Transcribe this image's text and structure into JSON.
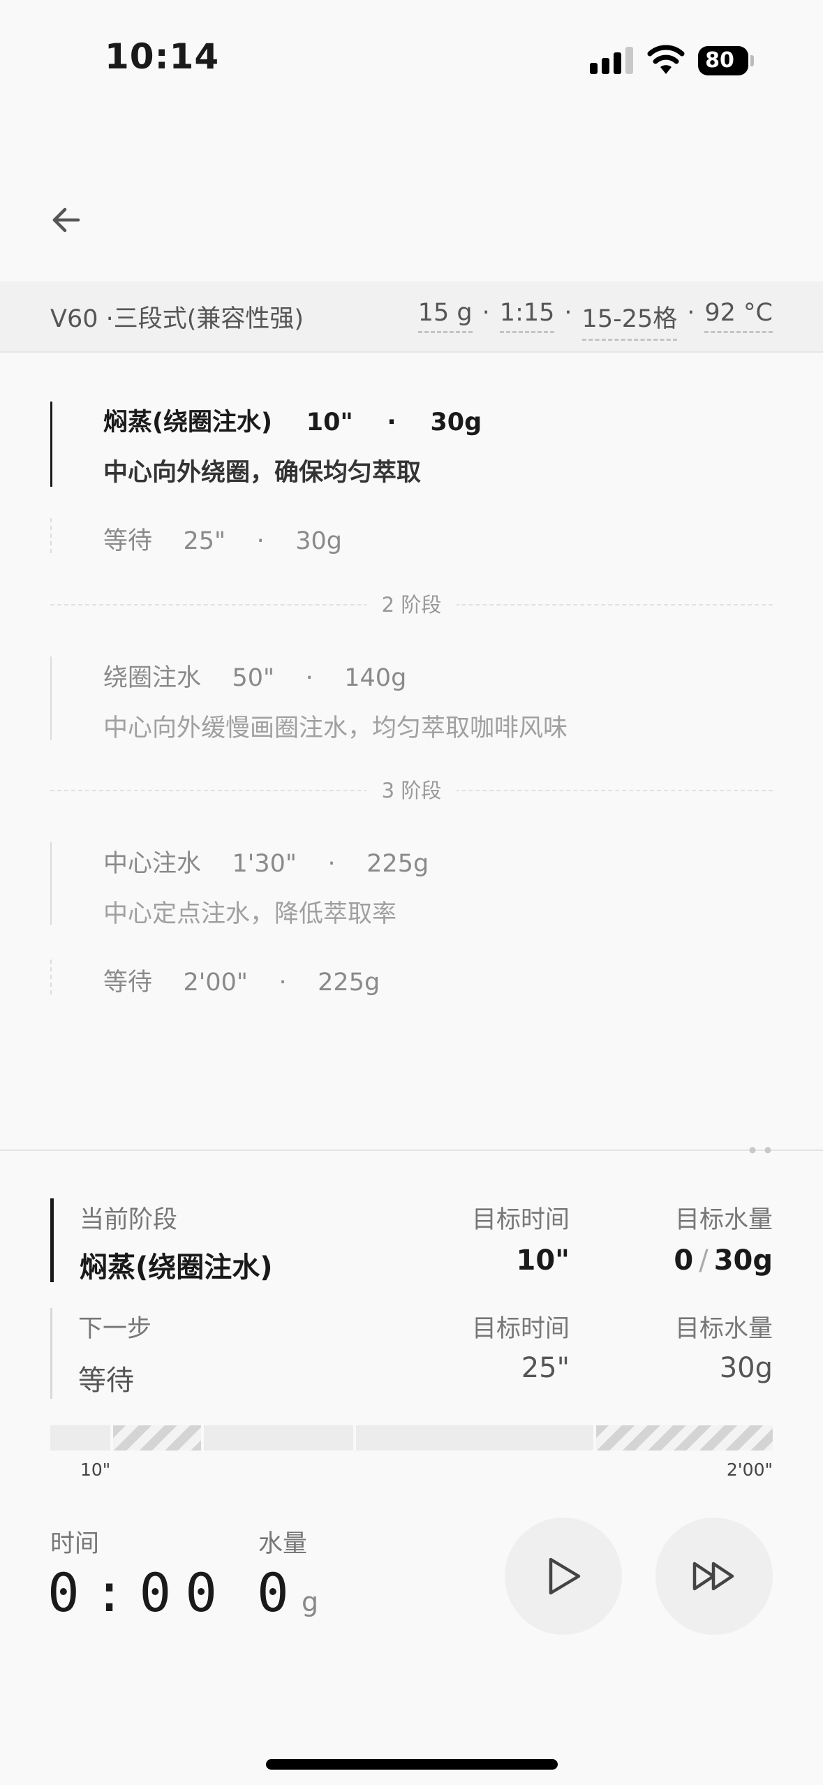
{
  "status_bar": {
    "time": "10:14",
    "battery": "80"
  },
  "recipe": {
    "title": "V60 ·三段式(兼容性强)",
    "params": [
      "15 g",
      "1:15",
      "15-25格",
      "92 °C"
    ]
  },
  "steps": [
    {
      "text": "焖蒸(绕圈注水)    10\"    ·    30g",
      "note": "中心向外绕圈，确保均匀萃取"
    },
    {
      "text": "等待    25\"    ·    30g"
    },
    {
      "text": "绕圈注水    50\"    ·    140g",
      "note": "中心向外缓慢画圈注水，均匀萃取咖啡风味"
    },
    {
      "text": "中心注水    1'30\"    ·    225g",
      "note": "中心定点注水，降低萃取率"
    },
    {
      "text": "等待    2'00\"    ·    225g"
    }
  ],
  "stages": [
    "2 阶段",
    "3 阶段"
  ],
  "current": {
    "label": "当前阶段",
    "name": "焖蒸(绕圈注水)",
    "time_label": "目标时间",
    "time": "10\"",
    "water_label": "目标水量",
    "water_now": "0",
    "water_sep": "/",
    "water_target": "30g"
  },
  "next": {
    "label": "下一步",
    "name": "等待",
    "time_label": "目标时间",
    "time": "25\"",
    "water_label": "目标水量",
    "water": "30g"
  },
  "progress": {
    "start_label": "10\"",
    "end_label": "2'00\""
  },
  "timer": {
    "time_label": "时间",
    "time": "0:00",
    "water_label": "水量",
    "water": "0",
    "water_unit": "g"
  },
  "icons": {
    "back": "arrow-left-icon",
    "play": "play-icon",
    "skip": "fast-forward-icon"
  }
}
